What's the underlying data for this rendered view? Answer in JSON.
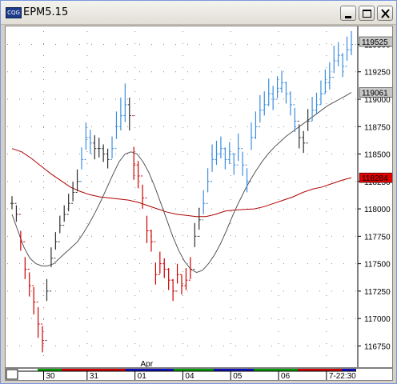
{
  "window": {
    "title": "EPM5.15",
    "icon_name": "cqg-app-icon",
    "buttons": [
      "minimize-icon",
      "maximize-icon",
      "close-icon"
    ]
  },
  "chart_data": {
    "type": "bar",
    "symbol": "EPM5.15",
    "y_ticks": [
      116750,
      117000,
      117250,
      117500,
      117750,
      118000,
      118250,
      118500,
      118750,
      119000,
      119250,
      119500
    ],
    "ylim": [
      116600,
      119620
    ],
    "price_tags": [
      {
        "label": "119525",
        "value": 119525,
        "color": "#000000",
        "bg": "#c8c8c8"
      },
      {
        "label": "119061",
        "value": 119061,
        "color": "#000000",
        "bg": "#c8c8c8"
      },
      {
        "label": "118284",
        "value": 118284,
        "color": "#000000",
        "bg": "#e00000"
      }
    ],
    "x_labels": [
      {
        "label": "30",
        "index": 8
      },
      {
        "label": "31",
        "index": 18
      },
      {
        "label": "01",
        "index": 29
      },
      {
        "label": "04",
        "index": 40
      },
      {
        "label": "05",
        "index": 51
      },
      {
        "label": "06",
        "index": 62
      },
      {
        "label": "7-22:30",
        "index": 73
      }
    ],
    "month_label": {
      "label": "Apr",
      "index": 31
    },
    "bar_colors": {
      "down": "#cc0000",
      "neutral": "#303030",
      "up": "#3b8ee0"
    },
    "bars": {
      "close": [
        118050,
        117950,
        117700,
        117450,
        117300,
        117150,
        116950,
        116800,
        117250,
        117550,
        117700,
        117850,
        117950,
        118050,
        118150,
        118250,
        118450,
        118650,
        118600,
        118550,
        118550,
        118500,
        118450,
        118550,
        118750,
        118850,
        118950,
        118850,
        118400,
        118300,
        118100,
        117800,
        117700,
        117400,
        117500,
        117450,
        117350,
        117250,
        117400,
        117300,
        117350,
        117450,
        117750,
        117900,
        118050,
        118250,
        118450,
        118500,
        118550,
        118450,
        118500,
        118400,
        118550,
        118400,
        118250,
        118650,
        118750,
        118900,
        118950,
        119050,
        119000,
        119100,
        119150,
        119050,
        118950,
        118800,
        118650,
        118600,
        118800,
        118900,
        118950,
        119050,
        119150,
        119200,
        119350,
        119400,
        119300,
        119450,
        119500
      ],
      "range": [
        120,
        150,
        180,
        200,
        220,
        250,
        280,
        240,
        200,
        180,
        160,
        160,
        150,
        160,
        180,
        200,
        200,
        250,
        220,
        220,
        180,
        160,
        180,
        200,
        250,
        300,
        350,
        300,
        300,
        250,
        220,
        250,
        200,
        200,
        200,
        180,
        200,
        200,
        180,
        180,
        200,
        200,
        220,
        200,
        220,
        220,
        250,
        220,
        200,
        200,
        200,
        200,
        250,
        220,
        220,
        250,
        250,
        250,
        220,
        250,
        220,
        200,
        200,
        200,
        220,
        220,
        220,
        200,
        200,
        220,
        200,
        220,
        220,
        250,
        250,
        220,
        220,
        220,
        220
      ],
      "class": [
        "n",
        "n",
        "d",
        "d",
        "d",
        "d",
        "d",
        "d",
        "n",
        "n",
        "n",
        "n",
        "n",
        "n",
        "n",
        "n",
        "u",
        "u",
        "u",
        "n",
        "n",
        "n",
        "n",
        "u",
        "u",
        "u",
        "u",
        "n",
        "d",
        "d",
        "d",
        "d",
        "d",
        "d",
        "d",
        "d",
        "d",
        "d",
        "d",
        "d",
        "d",
        "d",
        "n",
        "n",
        "u",
        "u",
        "u",
        "u",
        "u",
        "u",
        "u",
        "u",
        "u",
        "u",
        "u",
        "u",
        "u",
        "u",
        "u",
        "u",
        "u",
        "u",
        "u",
        "u",
        "u",
        "u",
        "n",
        "n",
        "n",
        "u",
        "u",
        "u",
        "u",
        "u",
        "u",
        "u",
        "u",
        "u",
        "u"
      ]
    },
    "moving_average_fast": {
      "name": "",
      "color": "#555555",
      "values": [
        117950,
        117800,
        117650,
        117550,
        117500,
        117480,
        117480,
        117500,
        117550,
        117600,
        117650,
        117700,
        117780,
        117870,
        117970,
        118080,
        118200,
        118320,
        118430,
        118500,
        118520,
        118500,
        118430,
        118330,
        118200,
        118050,
        117900,
        117750,
        117620,
        117520,
        117450,
        117420,
        117440,
        117500,
        117580,
        117680,
        117800,
        117930,
        118050,
        118160,
        118260,
        118350,
        118430,
        118500,
        118560,
        118610,
        118660,
        118700,
        118740,
        118780,
        118820,
        118860,
        118900,
        118940,
        118970,
        119000,
        119030,
        119061
      ]
    },
    "moving_average_slow": {
      "name": "",
      "color": "#b00000",
      "values": [
        118550,
        118520,
        118460,
        118390,
        118320,
        118260,
        118200,
        118160,
        118130,
        118110,
        118100,
        118090,
        118080,
        118060,
        118030,
        118000,
        117970,
        117950,
        117940,
        117930,
        117930,
        117950,
        117980,
        117990,
        117995,
        118000,
        118020,
        118050,
        118080,
        118110,
        118150,
        118180,
        118200,
        118230,
        118260,
        118284
      ]
    }
  }
}
